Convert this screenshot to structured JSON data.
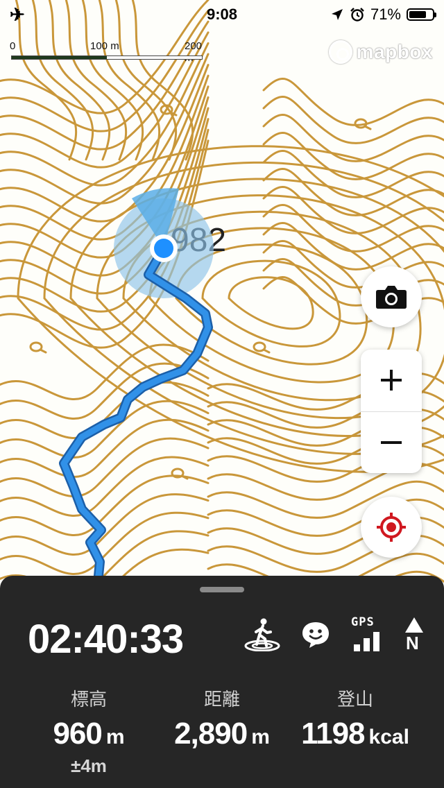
{
  "status_bar": {
    "time": "9:08",
    "battery_text": "71%",
    "battery_level": 0.71,
    "icons": [
      "airplane-mode-icon",
      "location-arrow-icon",
      "alarm-icon",
      "battery-icon"
    ]
  },
  "map": {
    "scale": {
      "labels": [
        "0",
        "100 m",
        "200 m"
      ]
    },
    "attribution": "mapbox",
    "peak_label": "982",
    "colors": {
      "contour": "#c9973a",
      "track": "#2d8de0",
      "accuracy": "#8ec3ea",
      "location": "#1e90ff"
    }
  },
  "controls": {
    "camera_icon": "camera-icon",
    "zoom_in_symbol": "+",
    "zoom_out_symbol": "−",
    "locate_icon": "crosshair-icon",
    "locate_color": "#d01820"
  },
  "panel": {
    "elapsed_time": "02:40:33",
    "status_icons": [
      "hiker-icon",
      "smiley-icon",
      "gps-signal-icon",
      "north-compass-icon"
    ],
    "gps_label": "GPS",
    "north_label": "N",
    "stats": {
      "elevation": {
        "label": "標高",
        "value": "960",
        "unit": "m",
        "accuracy": "±4m"
      },
      "distance": {
        "label": "距離",
        "value": "2,890",
        "unit": "m"
      },
      "climb": {
        "label": "登山",
        "value": "1198",
        "unit": "kcal"
      }
    }
  }
}
